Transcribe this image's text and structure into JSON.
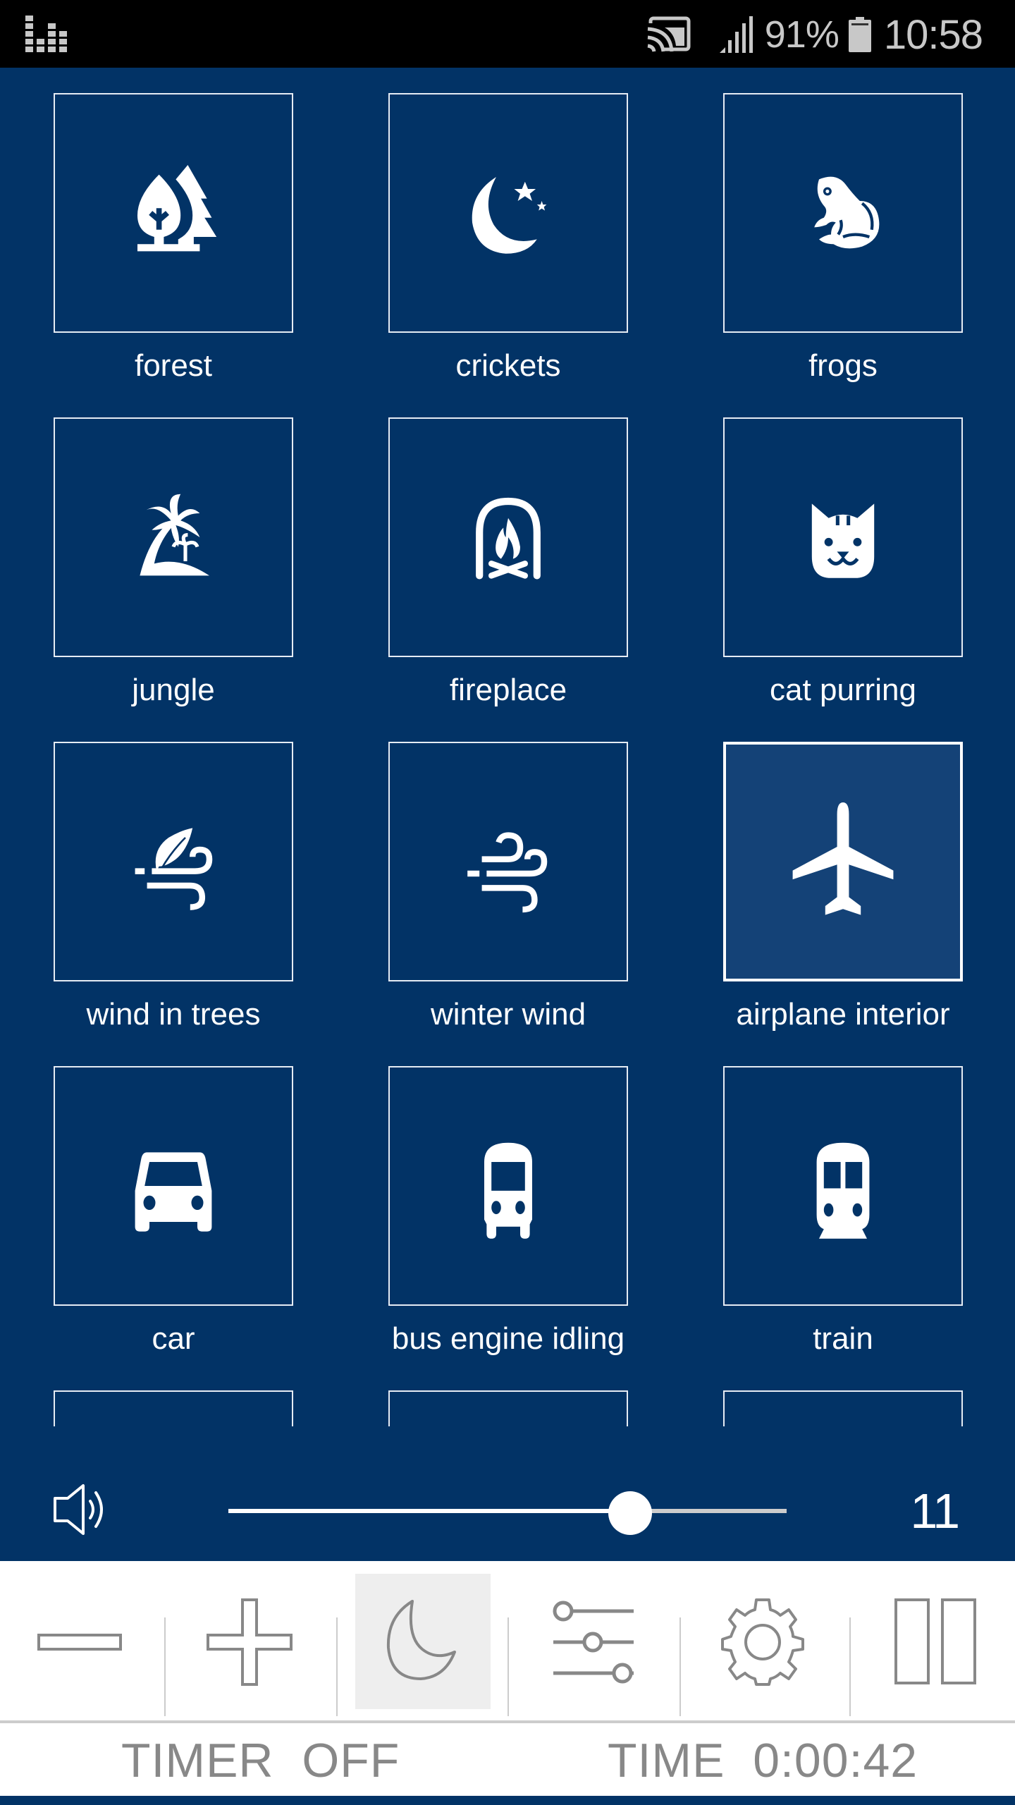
{
  "status_bar": {
    "left_icon": "equalizer-icon",
    "cast_icon": "cast-icon",
    "signal_icon": "signal-icon",
    "battery_percent": "91%",
    "battery_icon": "battery-icon",
    "time": "10:58"
  },
  "colors": {
    "background": "#023366",
    "tile_border": "#e6ecf4",
    "selected_tile_fill": "#144277",
    "toolbar_bg": "#ffffff",
    "toolbar_icon": "#888888",
    "active_tool_bg": "#eeeeee",
    "slider_fill": "#ffffff",
    "slider_track": "#cccccc"
  },
  "sounds": [
    {
      "label": "forest",
      "icon": "forest-icon",
      "selected": false
    },
    {
      "label": "crickets",
      "icon": "moon-stars-icon",
      "selected": false
    },
    {
      "label": "frogs",
      "icon": "frog-icon",
      "selected": false
    },
    {
      "label": "jungle",
      "icon": "palm-island-icon",
      "selected": false
    },
    {
      "label": "fireplace",
      "icon": "fireplace-icon",
      "selected": false
    },
    {
      "label": "cat purring",
      "icon": "cat-icon",
      "selected": false
    },
    {
      "label": "wind in trees",
      "icon": "wind-leaf-icon",
      "selected": false
    },
    {
      "label": "winter wind",
      "icon": "wind-icon",
      "selected": false
    },
    {
      "label": "airplane interior",
      "icon": "airplane-icon",
      "selected": true
    },
    {
      "label": "car",
      "icon": "car-icon",
      "selected": false
    },
    {
      "label": "bus engine idling",
      "icon": "bus-icon",
      "selected": false
    },
    {
      "label": "train",
      "icon": "train-icon",
      "selected": false
    },
    {
      "label": "",
      "icon": "",
      "selected": false
    },
    {
      "label": "",
      "icon": "",
      "selected": false
    },
    {
      "label": "",
      "icon": "",
      "selected": false
    }
  ],
  "volume": {
    "icon": "speaker-icon",
    "value": "11",
    "fraction": 0.72
  },
  "toolbar": {
    "buttons": [
      {
        "name": "decrease-button",
        "icon": "minus-icon",
        "active": false
      },
      {
        "name": "increase-button",
        "icon": "plus-icon",
        "active": false
      },
      {
        "name": "sleep-timer-button",
        "icon": "moon-icon",
        "active": true
      },
      {
        "name": "mixer-button",
        "icon": "sliders-icon",
        "active": false
      },
      {
        "name": "settings-button",
        "icon": "gear-icon",
        "active": false
      },
      {
        "name": "pause-button",
        "icon": "pause-icon",
        "active": false
      }
    ]
  },
  "timer": {
    "timer_label": "TIMER  OFF",
    "time_label": "TIME  0:00:42"
  }
}
